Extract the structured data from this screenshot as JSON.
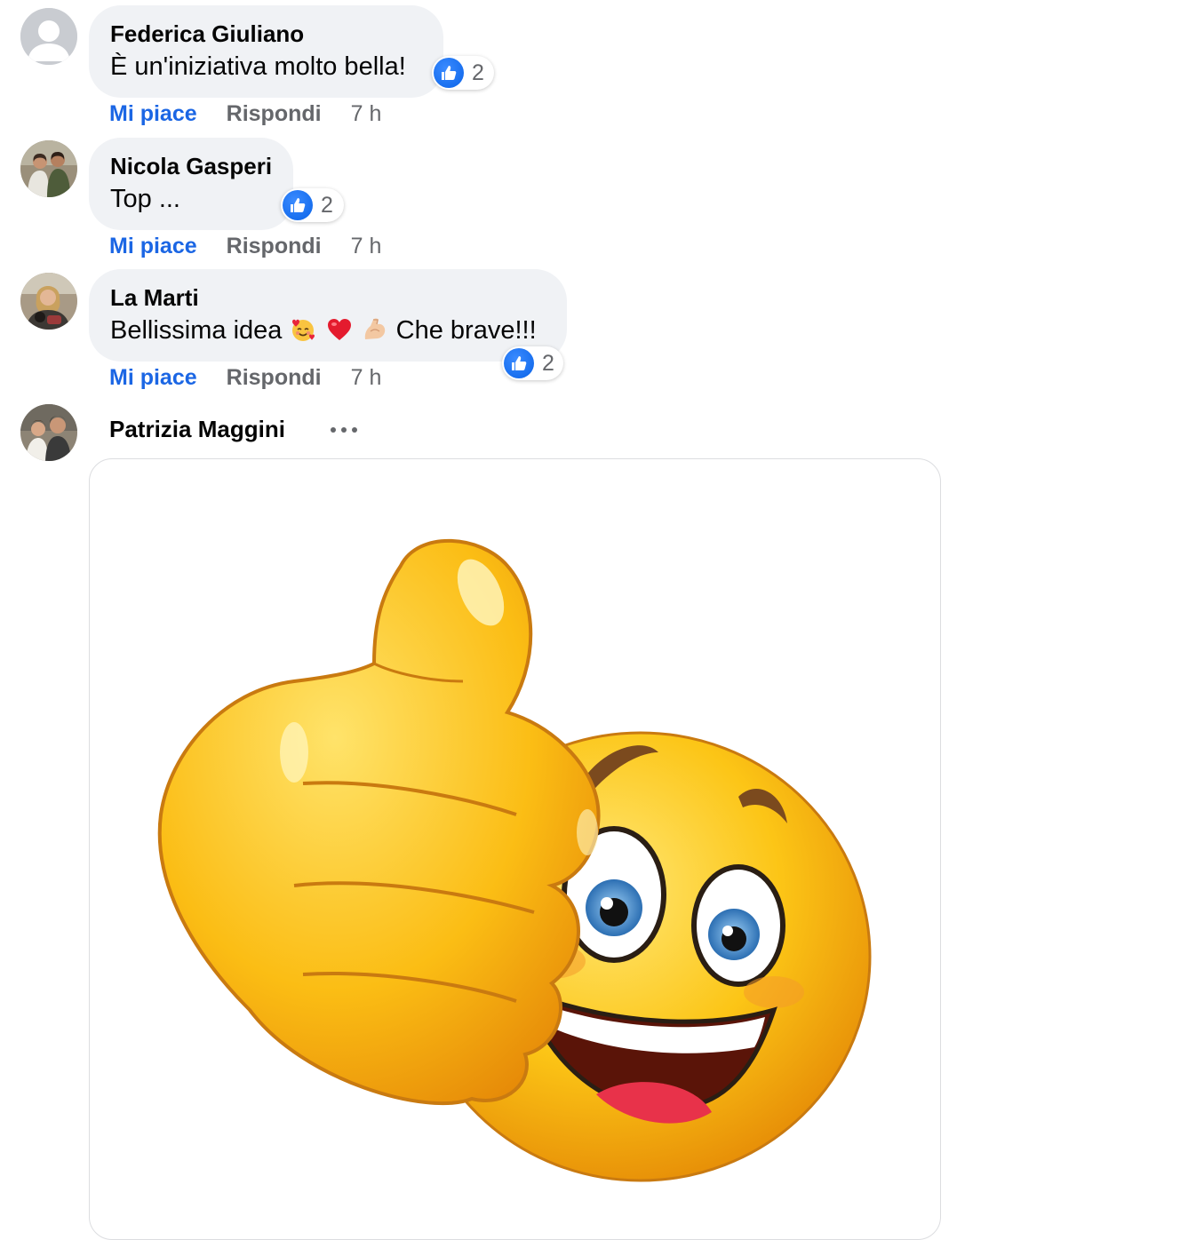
{
  "comments": [
    {
      "author": "Federica Giuliano",
      "text": "È un'iniziativa molto bella!",
      "reaction_count": "2",
      "actions": {
        "like": "Mi piace",
        "reply": "Rispondi",
        "time": "7 h"
      }
    },
    {
      "author": "Nicola Gasperi",
      "text": "Top ...",
      "reaction_count": "2",
      "actions": {
        "like": "Mi piace",
        "reply": "Rispondi",
        "time": "7 h"
      }
    },
    {
      "author": "La Marti",
      "text_before": "Bellissima idea",
      "text_after": "Che brave!!!",
      "reaction_count": "2",
      "actions": {
        "like": "Mi piace",
        "reply": "Rispondi",
        "time": "7 h"
      }
    },
    {
      "author": "Patrizia Maggini",
      "media": "thumbs-up-smiley-image"
    }
  ],
  "colors": {
    "bubble": "#f0f2f5",
    "like_blue": "#1b66e4",
    "secondary_text": "#65676b"
  }
}
